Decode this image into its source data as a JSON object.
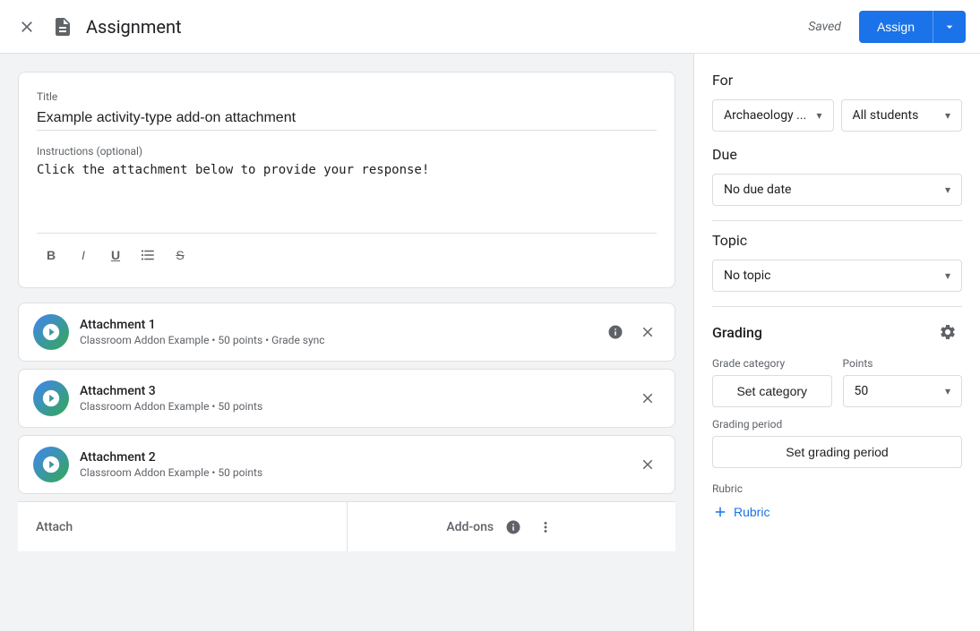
{
  "header": {
    "title": "Assignment",
    "saved_text": "Saved",
    "assign_label": "Assign",
    "close_icon": "×",
    "dropdown_icon": "▾"
  },
  "assignment": {
    "title_label": "Title",
    "title_value": "Example activity-type add-on attachment",
    "instructions_label": "Instructions (optional)",
    "instructions_value": "Click the attachment below to provide your response!"
  },
  "toolbar": {
    "bold": "B",
    "italic": "I",
    "underline": "U",
    "list": "☰",
    "strikethrough": "S"
  },
  "attachments": [
    {
      "name": "Attachment 1",
      "meta": "Classroom Addon Example • 50 points • Grade sync"
    },
    {
      "name": "Attachment 3",
      "meta": "Classroom Addon Example • 50 points"
    },
    {
      "name": "Attachment 2",
      "meta": "Classroom Addon Example • 50 points"
    }
  ],
  "bottom_bar": {
    "attach_label": "Attach",
    "addons_label": "Add-ons"
  },
  "right_panel": {
    "for_label": "For",
    "class_value": "Archaeology ...",
    "students_value": "All students",
    "due_label": "Due",
    "due_value": "No due date",
    "topic_label": "Topic",
    "topic_value": "No topic",
    "grading_label": "Grading",
    "grade_category_label": "Grade category",
    "points_label": "Points",
    "set_category_label": "Set category",
    "points_value": "50",
    "grading_period_label": "Grading period",
    "set_grading_period_label": "Set grading period",
    "rubric_label": "Rubric",
    "add_rubric_label": "Rubric"
  }
}
